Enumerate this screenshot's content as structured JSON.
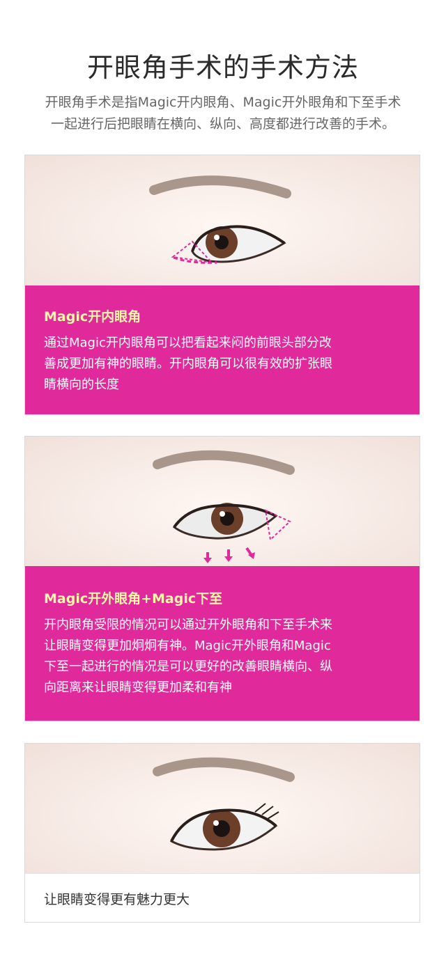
{
  "title": "开眼角手术的手术方法",
  "intro": {
    "line1": "开眼角手术是指Magic开内眼角、Magic开外眼角和下至手术",
    "line2": "一起进行后把眼睛在横向、纵向、高度都进行改善的手术。"
  },
  "sections": [
    {
      "heading": "Magic开内眼角",
      "lines": [
        "通过Magic开内眼角可以把看起来闷的前眼头部分改",
        "善成更加有神的眼睛。开内眼角可以很有效的扩张眼",
        "睛横向的长度"
      ]
    },
    {
      "heading": "Magic开外眼角+Magic下至",
      "lines": [
        "开内眼角受限的情况可以通过开外眼角和下至手术来",
        "让眼睛变得更加炯炯有神。Magic开外眼角和Magic",
        "下至一起进行的情况是可以更好的改善眼睛横向、纵",
        "向距离来让眼睛变得更加柔和有神"
      ]
    },
    {
      "text": "让眼睛变得更有魅力更大"
    }
  ],
  "colors": {
    "accent": "#e0299b",
    "heading_yellow": "#fff7a8"
  }
}
